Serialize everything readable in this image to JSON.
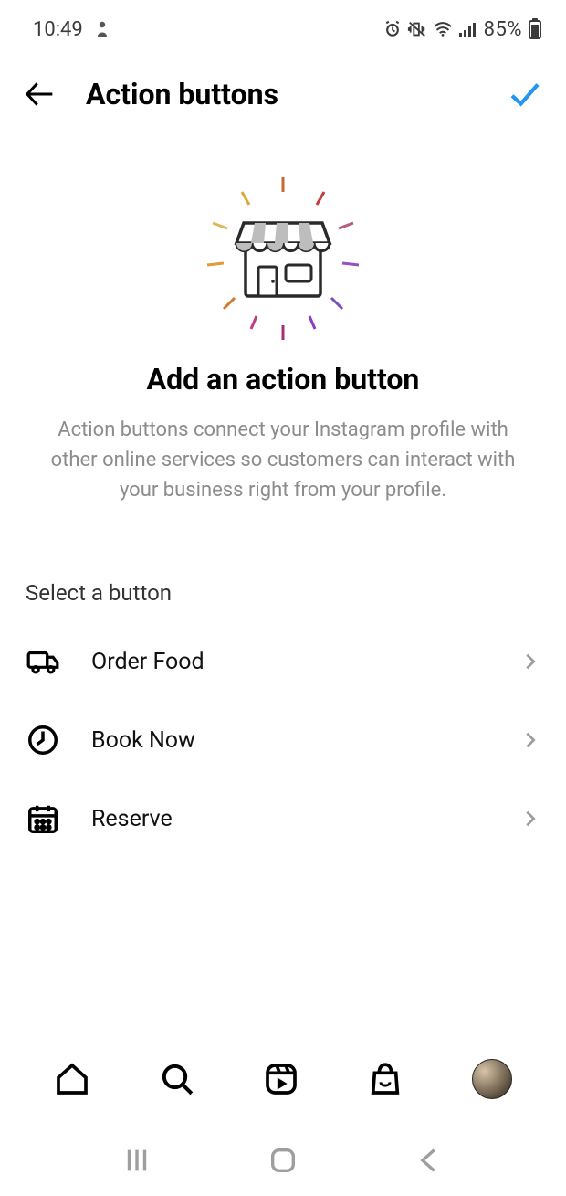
{
  "status": {
    "time": "10:49",
    "battery_pct": "85%"
  },
  "header": {
    "title": "Action buttons"
  },
  "hero": {
    "title": "Add an action button",
    "description": "Action buttons connect your Instagram profile with other online services so customers can interact with your business right from your profile."
  },
  "section": {
    "label": "Select a button"
  },
  "options": {
    "order_food": "Order Food",
    "book_now": "Book Now",
    "reserve": "Reserve"
  }
}
